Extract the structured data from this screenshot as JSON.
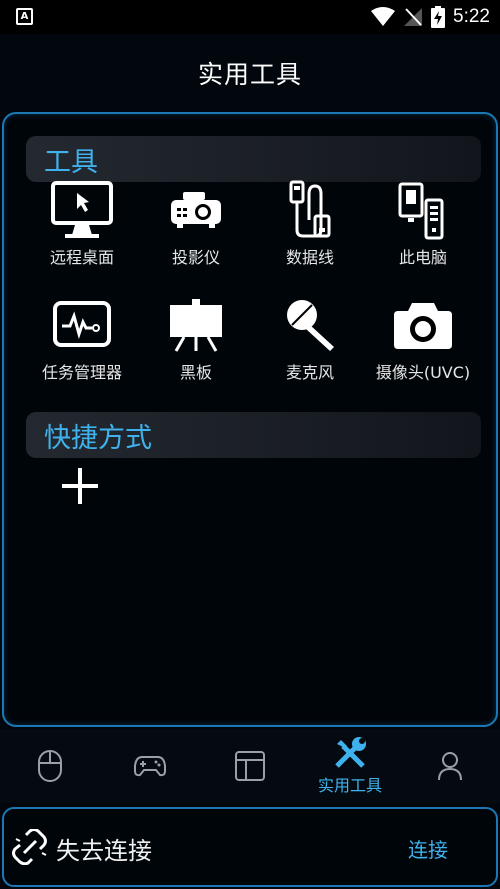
{
  "status_bar": {
    "time": "5:22",
    "notification_icon": "a-notification-icon",
    "icons": [
      "wifi-icon",
      "signal-icon",
      "battery-charging-icon"
    ]
  },
  "header": {
    "title": "实用工具"
  },
  "tools_section": {
    "title": "工具",
    "items": [
      {
        "label": "远程桌面",
        "icon": "monitor-icon"
      },
      {
        "label": "投影仪",
        "icon": "projector-icon"
      },
      {
        "label": "数据线",
        "icon": "usb-cable-icon"
      },
      {
        "label": "此电脑",
        "icon": "computer-icon"
      },
      {
        "label": "任务管理器",
        "icon": "task-manager-icon"
      },
      {
        "label": "黑板",
        "icon": "blackboard-icon"
      },
      {
        "label": "麦克风",
        "icon": "microphone-icon"
      },
      {
        "label": "摄像头(UVC)",
        "icon": "camera-icon"
      }
    ]
  },
  "shortcuts_section": {
    "title": "快捷方式",
    "add_icon": "plus-icon"
  },
  "bottom_nav": {
    "items": [
      {
        "icon": "mouse-icon",
        "label": ""
      },
      {
        "icon": "gamepad-icon",
        "label": ""
      },
      {
        "icon": "layout-icon",
        "label": ""
      },
      {
        "icon": "tools-icon",
        "label": "实用工具",
        "active": true
      },
      {
        "icon": "user-icon",
        "label": ""
      }
    ]
  },
  "connection": {
    "status": "失去连接",
    "action": "连接",
    "icon": "broken-link-icon"
  },
  "colors": {
    "accent": "#3fb2ee",
    "border": "#1c78b4",
    "background": "#02070d"
  }
}
